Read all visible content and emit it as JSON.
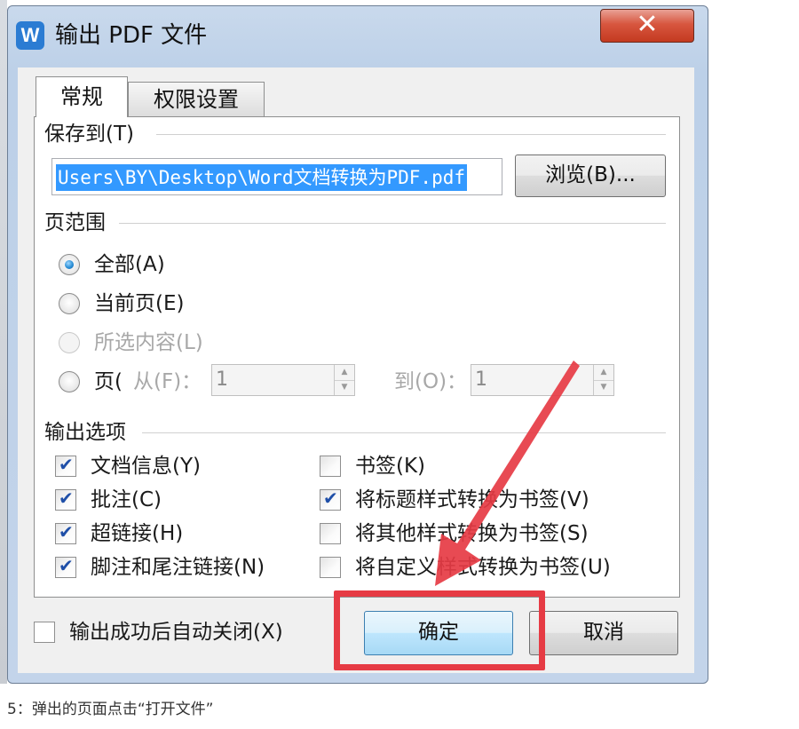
{
  "window": {
    "title": "输出 PDF 文件",
    "app_icon_letter": "W",
    "close_glyph": "✕"
  },
  "tabs": [
    {
      "label": "常规",
      "active": true
    },
    {
      "label": "权限设置",
      "active": false
    }
  ],
  "save_to": {
    "label": "保存到(T)",
    "path": "Users\\BY\\Desktop\\Word文档转换为PDF.pdf",
    "browse_label": "浏览(B)..."
  },
  "page_range": {
    "label": "页范围",
    "options": [
      {
        "label": "全部(A)",
        "checked": true,
        "enabled": true
      },
      {
        "label": "当前页(E)",
        "checked": false,
        "enabled": true
      },
      {
        "label": "所选内容(L)",
        "checked": false,
        "enabled": false
      },
      {
        "label": "页(",
        "checked": false,
        "enabled": true
      }
    ],
    "from_label": "从(F)：",
    "from_value": "1",
    "to_label": "到(O)：",
    "to_value": "1"
  },
  "output_options": {
    "label": "输出选项",
    "left": [
      {
        "label": "文档信息(Y)",
        "checked": true
      },
      {
        "label": "批注(C)",
        "checked": true
      },
      {
        "label": "超链接(H)",
        "checked": true
      },
      {
        "label": "脚注和尾注链接(N)",
        "checked": true
      }
    ],
    "right": [
      {
        "label": "书签(K)",
        "checked": false
      },
      {
        "label": "将标题样式转换为书签(V)",
        "checked": true
      },
      {
        "label": "将其他样式转换为书签(S)",
        "checked": false
      },
      {
        "label": "将自定义样式转换为书签(U)",
        "checked": false
      }
    ]
  },
  "footer": {
    "auto_close_label": "输出成功后自动关闭(X)",
    "auto_close_checked": false,
    "ok_label": "确定",
    "cancel_label": "取消"
  },
  "annotation": {
    "color": "#e63b44"
  },
  "caption": "5：弹出的页面点击“打开文件”",
  "colors": {
    "selection": "#3399ff",
    "close_button": "#c43a20",
    "default_button": "#bee6fd",
    "app_icon": "#2b7cd3"
  }
}
